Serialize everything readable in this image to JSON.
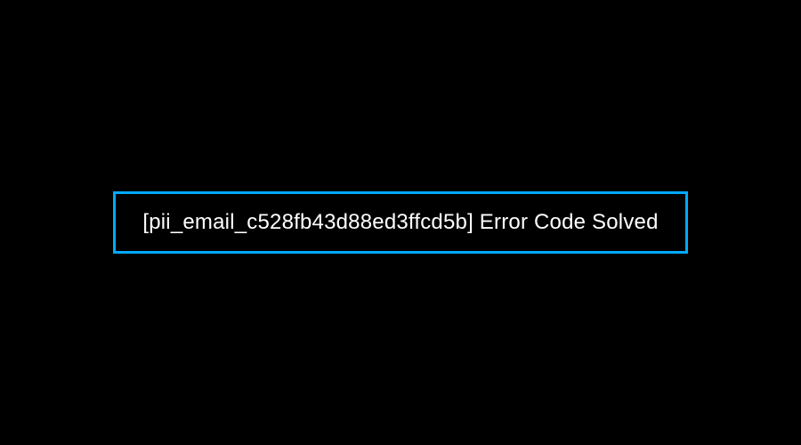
{
  "message": {
    "text": "[pii_email_c528fb43d88ed3ffcd5b] Error Code Solved"
  },
  "colors": {
    "background": "#000000",
    "border": "#00aaff",
    "text": "#ffffff"
  }
}
